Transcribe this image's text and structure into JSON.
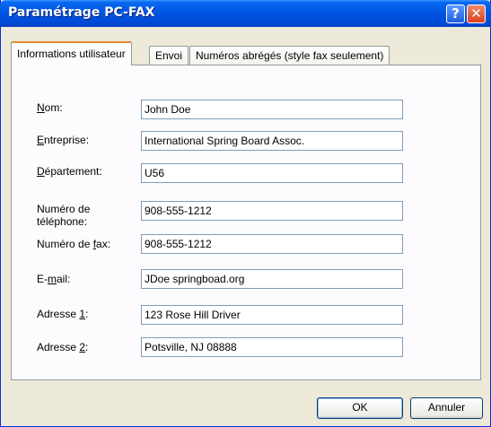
{
  "window": {
    "title": "Paramétrage PC-FAX"
  },
  "titlebar_buttons": {
    "help": "?",
    "close": "✕"
  },
  "tabs": [
    {
      "label": "Informations utilisateur",
      "active": true
    },
    {
      "label": "Envoi",
      "active": false
    },
    {
      "label": "Numéros abrégés (style fax seulement)",
      "active": false
    }
  ],
  "form": {
    "nom": {
      "label_pre": "",
      "label_key": "N",
      "label_post": "om:",
      "value": "John Doe"
    },
    "entreprise": {
      "label_pre": "",
      "label_key": "E",
      "label_post": "ntreprise:",
      "value": "International Spring Board Assoc."
    },
    "departement": {
      "label_pre": "",
      "label_key": "D",
      "label_post": "épartement:",
      "value": "U56"
    },
    "telephone": {
      "label_line1": "Numéro de",
      "label_line2": "téléphone:",
      "value": "908-555-1212"
    },
    "fax": {
      "label_pre": "Numéro de ",
      "label_key": "f",
      "label_post": "ax:",
      "value": "908-555-1212"
    },
    "email": {
      "label_pre": "E-",
      "label_key": "m",
      "label_post": "ail:",
      "value": "JDoe springboad.org"
    },
    "adresse1": {
      "label_pre": "Adresse ",
      "label_key": "1",
      "label_post": ":",
      "value": "123 Rose Hill Driver"
    },
    "adresse2": {
      "label_pre": "Adresse ",
      "label_key": "2",
      "label_post": ":",
      "value": "Potsville, NJ 08888"
    }
  },
  "buttons": {
    "ok": "OK",
    "cancel": "Annuler"
  }
}
